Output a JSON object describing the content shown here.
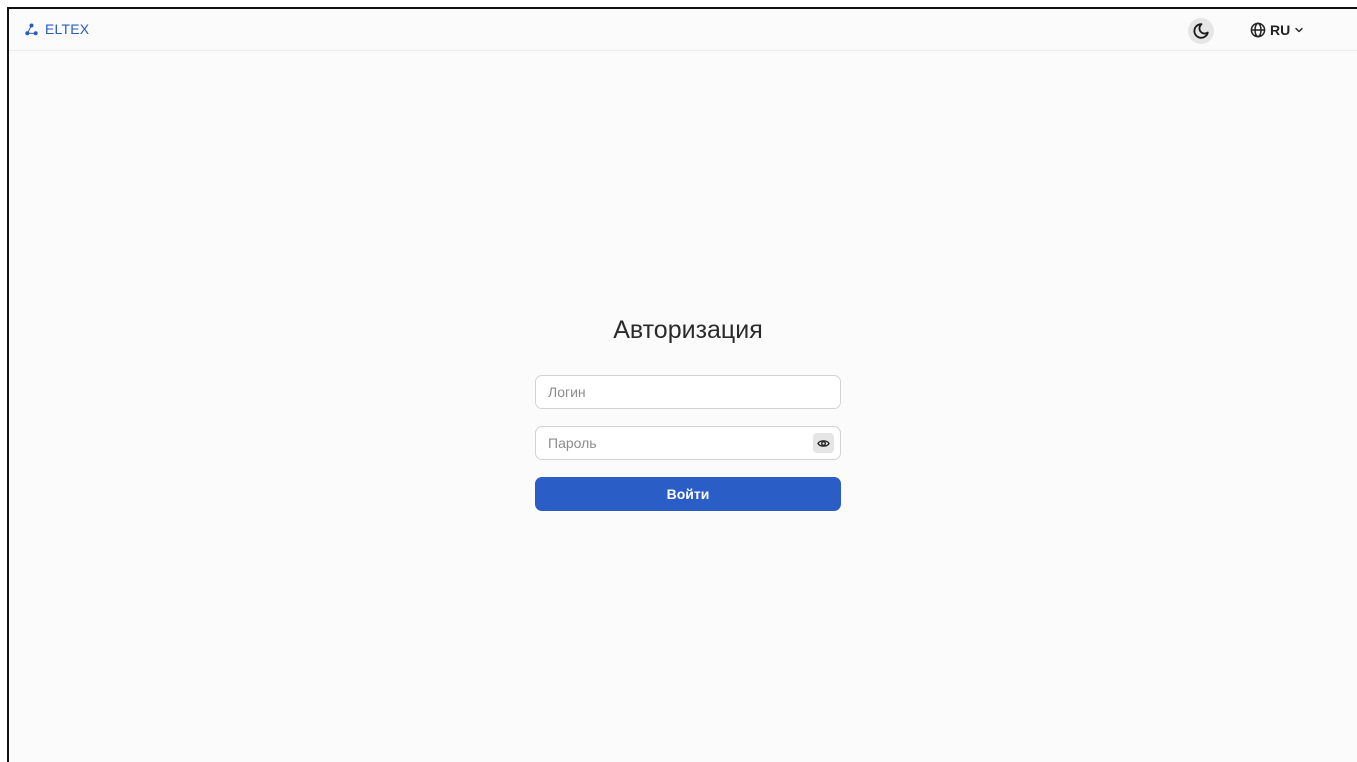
{
  "header": {
    "logo_text": "ELTEX",
    "language": "RU",
    "theme_icon": "moon-icon",
    "language_icon": "globe-icon"
  },
  "form": {
    "title": "Авторизация",
    "login_placeholder": "Логин",
    "login_value": "",
    "password_placeholder": "Пароль",
    "password_value": "",
    "password_toggle_icon": "eye-icon",
    "submit_label": "Войти"
  },
  "colors": {
    "accent": "#2a5ec6",
    "brand": "#2a5bbd",
    "background": "#fbfbfb"
  }
}
